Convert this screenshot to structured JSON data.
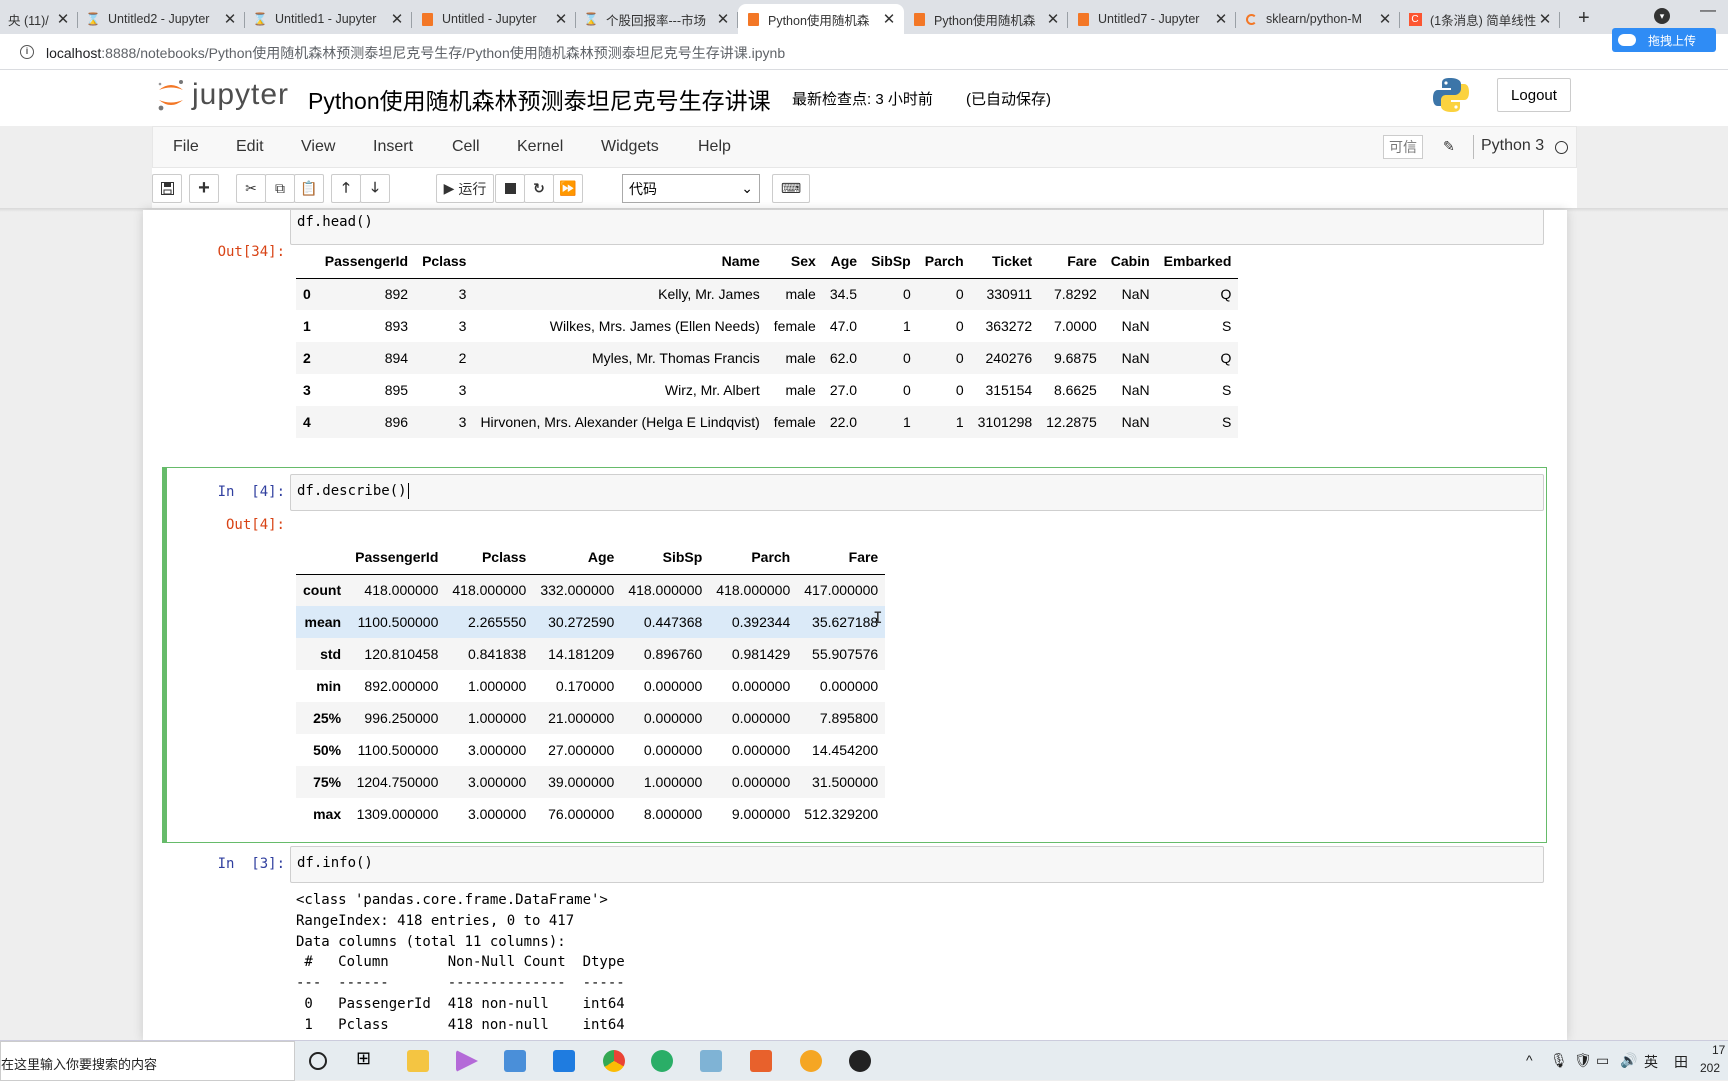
{
  "browser": {
    "tabs": [
      {
        "title": "央 (11)/",
        "icon": "hourglass-icon",
        "active": false
      },
      {
        "title": "Untitled2 - Jupyter",
        "icon": "hourglass-icon",
        "active": false
      },
      {
        "title": "Untitled1 - Jupyter",
        "icon": "hourglass-icon",
        "active": false
      },
      {
        "title": "Untitled - Jupyter",
        "icon": "notebook-icon",
        "active": false
      },
      {
        "title": "个股回报率---市场",
        "icon": "hourglass-icon",
        "active": false
      },
      {
        "title": "Python使用随机森",
        "icon": "notebook-icon",
        "active": true
      },
      {
        "title": "Python使用随机森",
        "icon": "notebook-icon",
        "active": false
      },
      {
        "title": "Untitled7 - Jupyter",
        "icon": "notebook-icon",
        "active": false
      },
      {
        "title": "sklearn/python-M",
        "icon": "loading-icon",
        "active": false
      },
      {
        "title": "(1条消息) 简单线性",
        "icon": "csdn-icon",
        "active": false
      }
    ],
    "url_host": "localhost",
    "url_rest": ":8888/notebooks/Python使用随机森林预测泰坦尼克号生存/Python使用随机森林预测泰坦尼克号生存讲课.ipynb",
    "upload_label": "拖拽上传"
  },
  "header": {
    "logo_text": "jupyter",
    "notebook_title": "Python使用随机森林预测泰坦尼克号生存讲课",
    "checkpoint": "最新检查点: 3 小时前",
    "autosave": "(已自动保存)",
    "logout_label": "Logout"
  },
  "menubar": {
    "items": [
      "File",
      "Edit",
      "View",
      "Insert",
      "Cell",
      "Kernel",
      "Widgets",
      "Help"
    ],
    "trusted_label": "可信",
    "kernel_name": "Python 3"
  },
  "toolbar": {
    "run_label": "运行",
    "cell_type": "代码"
  },
  "cells": {
    "head": {
      "source": "df.head()",
      "out_prompt": "Out[34]:",
      "columns": [
        "",
        "PassengerId",
        "Pclass",
        "Name",
        "Sex",
        "Age",
        "SibSp",
        "Parch",
        "Ticket",
        "Fare",
        "Cabin",
        "Embarked"
      ],
      "rows": [
        [
          "0",
          "892",
          "3",
          "Kelly, Mr. James",
          "male",
          "34.5",
          "0",
          "0",
          "330911",
          "7.8292",
          "NaN",
          "Q"
        ],
        [
          "1",
          "893",
          "3",
          "Wilkes, Mrs. James (Ellen Needs)",
          "female",
          "47.0",
          "1",
          "0",
          "363272",
          "7.0000",
          "NaN",
          "S"
        ],
        [
          "2",
          "894",
          "2",
          "Myles, Mr. Thomas Francis",
          "male",
          "62.0",
          "0",
          "0",
          "240276",
          "9.6875",
          "NaN",
          "Q"
        ],
        [
          "3",
          "895",
          "3",
          "Wirz, Mr. Albert",
          "male",
          "27.0",
          "0",
          "0",
          "315154",
          "8.6625",
          "NaN",
          "S"
        ],
        [
          "4",
          "896",
          "3",
          "Hirvonen, Mrs. Alexander (Helga E Lindqvist)",
          "female",
          "22.0",
          "1",
          "1",
          "3101298",
          "12.2875",
          "NaN",
          "S"
        ]
      ]
    },
    "describe": {
      "in_prompt": "In  [4]:",
      "source": "df.describe()",
      "out_prompt": "Out[4]:",
      "columns": [
        "",
        "PassengerId",
        "Pclass",
        "Age",
        "SibSp",
        "Parch",
        "Fare"
      ],
      "rows": [
        [
          "count",
          "418.000000",
          "418.000000",
          "332.000000",
          "418.000000",
          "418.000000",
          "417.000000"
        ],
        [
          "mean",
          "1100.500000",
          "2.265550",
          "30.272590",
          "0.447368",
          "0.392344",
          "35.627188"
        ],
        [
          "std",
          "120.810458",
          "0.841838",
          "14.181209",
          "0.896760",
          "0.981429",
          "55.907576"
        ],
        [
          "min",
          "892.000000",
          "1.000000",
          "0.170000",
          "0.000000",
          "0.000000",
          "0.000000"
        ],
        [
          "25%",
          "996.250000",
          "1.000000",
          "21.000000",
          "0.000000",
          "0.000000",
          "7.895800"
        ],
        [
          "50%",
          "1100.500000",
          "3.000000",
          "27.000000",
          "0.000000",
          "0.000000",
          "14.454200"
        ],
        [
          "75%",
          "1204.750000",
          "3.000000",
          "39.000000",
          "1.000000",
          "0.000000",
          "31.500000"
        ],
        [
          "max",
          "1309.000000",
          "3.000000",
          "76.000000",
          "8.000000",
          "9.000000",
          "512.329200"
        ]
      ]
    },
    "info": {
      "in_prompt": "In  [3]:",
      "source": "df.info()",
      "output": "<class 'pandas.core.frame.DataFrame'>\nRangeIndex: 418 entries, 0 to 417\nData columns (total 11 columns):\n #   Column       Non-Null Count  Dtype\n---  ------       --------------  -----\n 0   PassengerId  418 non-null    int64\n 1   Pclass       418 non-null    int64"
    }
  },
  "taskbar": {
    "search_placeholder": "在这里输入你要搜索的内容",
    "ime_label": "英",
    "clock_time": "17",
    "clock_date": "202"
  },
  "colors": {
    "selected_cell_border": "#66bb6a",
    "in_prompt": "#303f9f",
    "out_prompt": "#d84315",
    "highlight_row": "#dbeaf8"
  }
}
